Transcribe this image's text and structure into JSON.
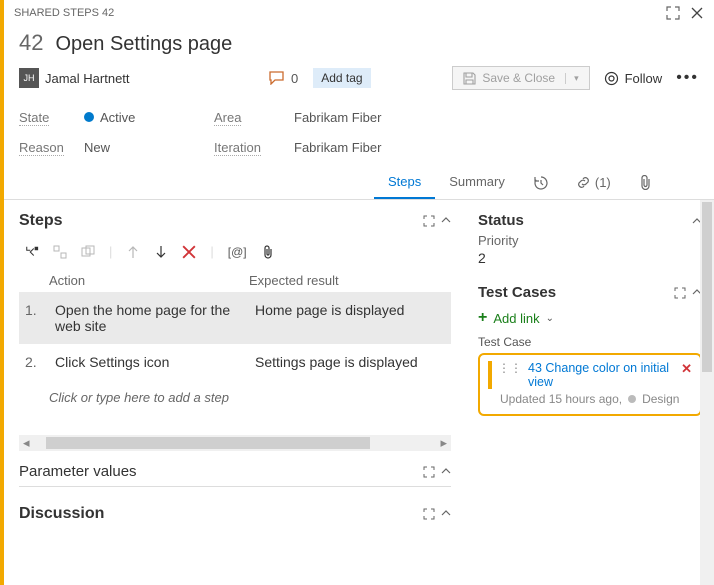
{
  "titlebar": {
    "label": "SHARED STEPS 42"
  },
  "header": {
    "id": "42",
    "title": "Open Settings page",
    "assignee": "Jamal Hartnett",
    "avatar_initials": "JH",
    "comment_count": "0",
    "add_tag": "Add tag",
    "save": "Save & Close",
    "follow": "Follow"
  },
  "fields": {
    "state_label": "State",
    "state_value": "Active",
    "reason_label": "Reason",
    "reason_value": "New",
    "area_label": "Area",
    "area_value": "Fabrikam Fiber",
    "iteration_label": "Iteration",
    "iteration_value": "Fabrikam Fiber"
  },
  "tabs": {
    "steps": "Steps",
    "summary": "Summary",
    "links_count": "(1)"
  },
  "steps": {
    "heading": "Steps",
    "col_action": "Action",
    "col_expected": "Expected result",
    "rows": [
      {
        "n": "1.",
        "action": "Open the home page for the web site",
        "expected": "Home page is displayed"
      },
      {
        "n": "2.",
        "action": "Click Settings icon",
        "expected": "Settings page is displayed"
      }
    ],
    "placeholder": "Click or type here to add a step"
  },
  "param": {
    "heading": "Parameter values"
  },
  "discussion": {
    "heading": "Discussion"
  },
  "side": {
    "status_heading": "Status",
    "priority_label": "Priority",
    "priority_value": "2",
    "tc_heading": "Test Cases",
    "add_link": "Add link",
    "tc_sub": "Test Case",
    "tc_link_id": "43",
    "tc_link_title": "Change color on initial view",
    "tc_meta_time": "Updated 15 hours ago,",
    "tc_meta_state": "Design"
  }
}
